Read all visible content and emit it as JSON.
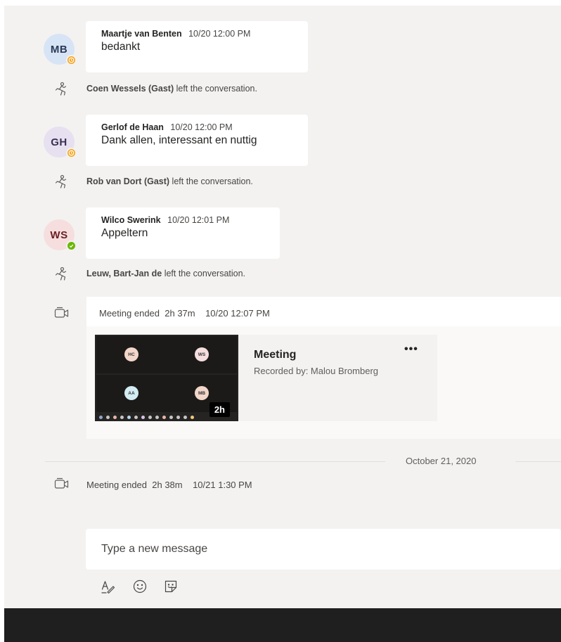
{
  "messages": [
    {
      "initials": "MB",
      "sender": "Maartje van Benten",
      "time": "10/20 12:00 PM",
      "text": "bedankt",
      "presence": "away",
      "avatar_bg": "#d7e4f5",
      "avatar_fg": "#2b3a55"
    },
    {
      "initials": "GH",
      "sender": "Gerlof de Haan",
      "time": "10/20 12:00 PM",
      "text": "Dank allen, interessant en nuttig",
      "presence": "away",
      "avatar_bg": "#e6e0f0",
      "avatar_fg": "#3b2f54"
    },
    {
      "initials": "WS",
      "sender": "Wilco Swerink",
      "time": "10/20 12:01 PM",
      "text": "Appeltern",
      "presence": "available",
      "avatar_bg": "#f6dede",
      "avatar_fg": "#6b1f1f"
    }
  ],
  "system_events": [
    {
      "name": "Coen Wessels (Gast)",
      "action": "left the conversation."
    },
    {
      "name": "Rob van Dort (Gast)",
      "action": "left the conversation."
    },
    {
      "name": "Leuw, Bart-Jan de",
      "action": "left the conversation."
    }
  ],
  "meeting_1": {
    "status": "Meeting ended",
    "duration": "2h 37m",
    "time": "10/20 12:07 PM",
    "recording": {
      "title": "Meeting",
      "subtitle": "Recorded by: Malou Bromberg",
      "more_label": "•••",
      "duration_badge": "2h",
      "participants": [
        {
          "initials": "HC",
          "color": "#f2d6c9"
        },
        {
          "initials": "WS",
          "color": "#f6dede"
        },
        {
          "initials": "AA",
          "color": "#d3ecf2"
        },
        {
          "initials": "MB",
          "color": "#f2d6c9"
        }
      ]
    }
  },
  "date_divider": "October 21, 2020",
  "meeting_2": {
    "status": "Meeting ended",
    "duration": "2h 38m",
    "time": "10/21 1:30 PM"
  },
  "compose": {
    "placeholder": "Type a new message"
  },
  "toolbar": {
    "icons": [
      "format-icon",
      "emoji-icon",
      "sticker-icon"
    ]
  },
  "colors": {
    "away": "#f8a51c",
    "available": "#6bb700",
    "background": "#f3f2f1"
  }
}
